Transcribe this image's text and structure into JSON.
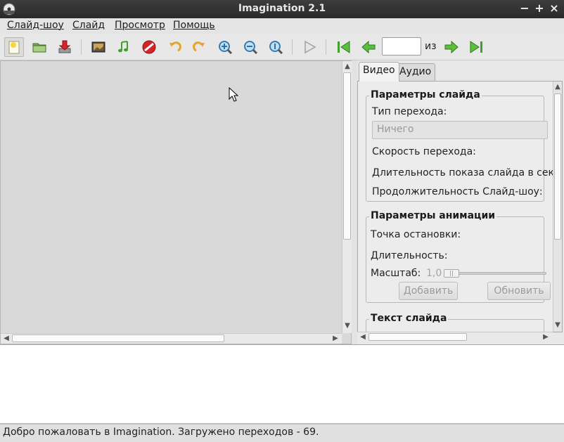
{
  "window": {
    "title": "Imagination 2.1",
    "controls": {
      "minimize": "−",
      "maximize": "+",
      "close": "×"
    }
  },
  "menubar": {
    "items": [
      {
        "label": "Слайд-шоу"
      },
      {
        "label": "Слайд"
      },
      {
        "label": "Просмотр"
      },
      {
        "label": "Помощь"
      }
    ]
  },
  "toolbar": {
    "slide_number_value": "",
    "of_label": "из",
    "buttons": [
      "new-slideshow-icon",
      "open-folder-icon",
      "save-icon",
      "import-pictures-icon",
      "import-music-icon",
      "delete-icon",
      "rotate-left-icon",
      "rotate-right-icon",
      "zoom-in-icon",
      "zoom-out-icon",
      "zoom-fit-icon",
      "play-icon",
      "first-slide-icon",
      "previous-slide-icon",
      "next-slide-icon",
      "last-slide-icon"
    ]
  },
  "right_panel": {
    "tabs": [
      {
        "label": "Видео",
        "selected": true
      },
      {
        "label": "Аудио",
        "selected": false
      }
    ],
    "slide_params": {
      "title": "Параметры слайда",
      "transition_type_label": "Тип перехода:",
      "transition_value": "Ничего",
      "transition_speed_label": "Скорость перехода:",
      "slide_duration_label": "Длительность показа слайда в сек",
      "slideshow_duration_label": "Продолжительность Слайд-шоу:"
    },
    "animation_params": {
      "title": "Параметры анимации",
      "stop_point_label": "Точка остановки:",
      "duration_label": "Длительность:",
      "zoom_label": "Масштаб:",
      "zoom_value": "1,0",
      "add_button": "Добавить",
      "update_button": "Обновить"
    },
    "slide_text": {
      "title": "Текст слайда"
    }
  },
  "statusbar": {
    "text": "Добро пожаловать в Imagination. Загружено переходов - 69."
  },
  "colors": {
    "titlebar": "#2f2f2f",
    "canvas": "#d9d9d9",
    "accent_green": "#3fa12a",
    "delete_red": "#d4262a"
  }
}
